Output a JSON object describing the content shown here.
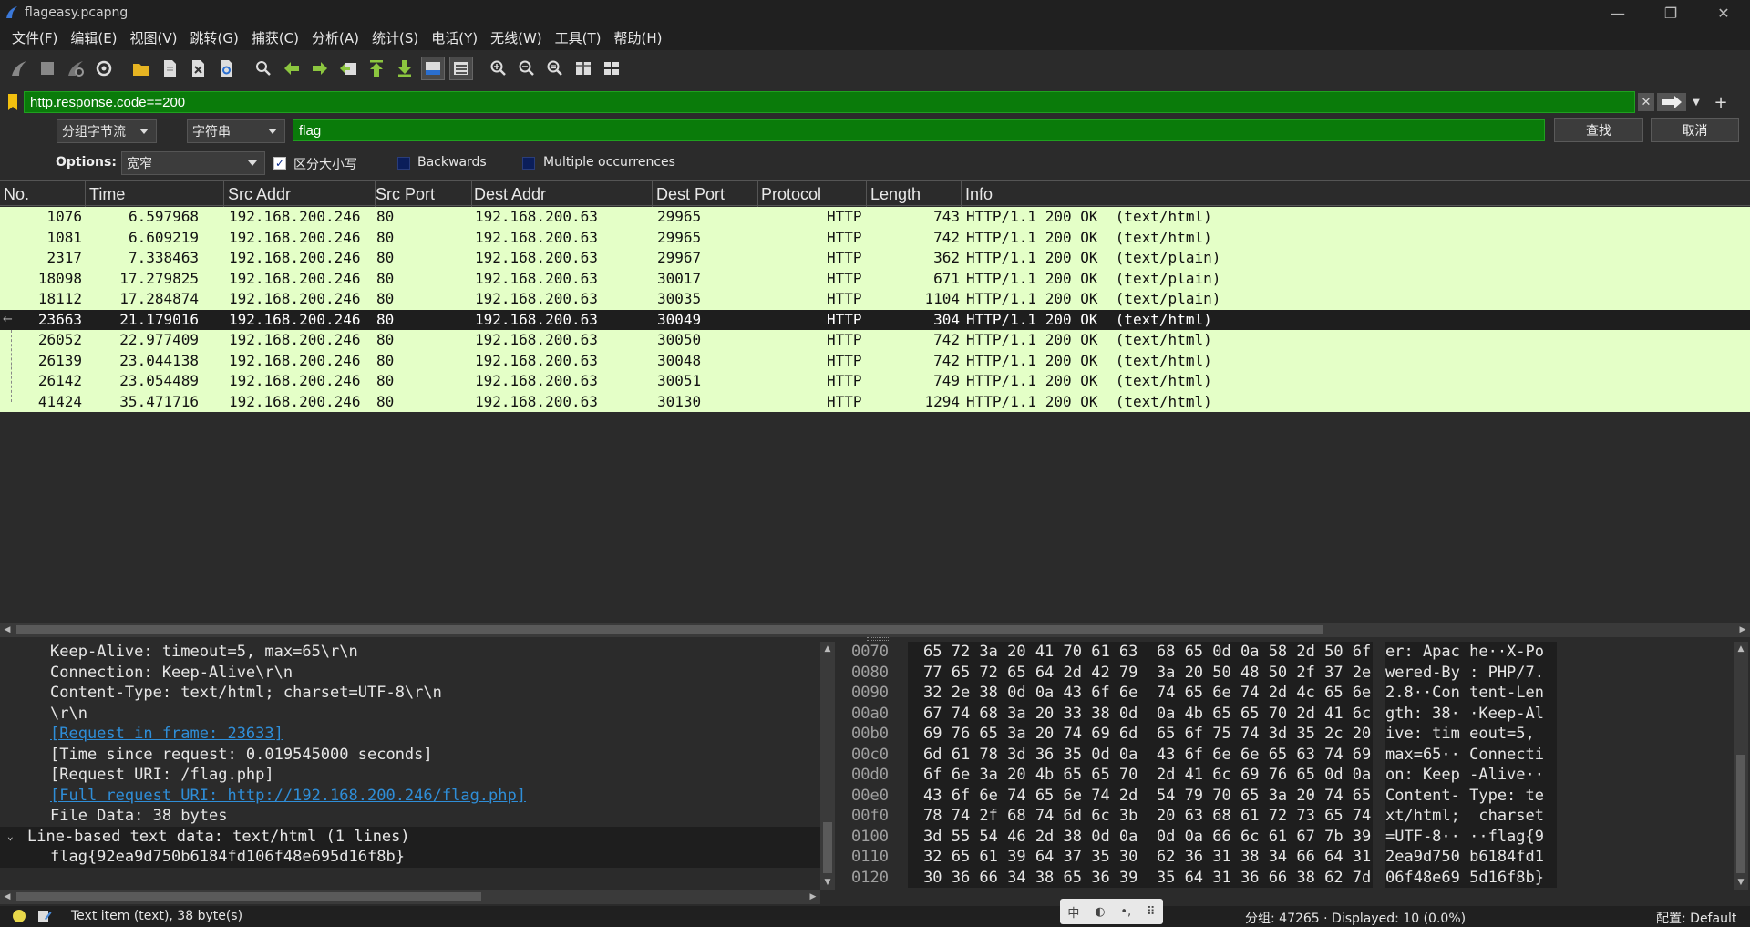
{
  "window": {
    "title": "flageasy.pcapng",
    "minimize": "—",
    "restore": "❐",
    "close": "✕"
  },
  "menu": [
    "文件(F)",
    "编辑(E)",
    "视图(V)",
    "跳转(G)",
    "捕获(C)",
    "分析(A)",
    "统计(S)",
    "电话(Y)",
    "无线(W)",
    "工具(T)",
    "帮助(H)"
  ],
  "filter": {
    "value": "http.response.code==200",
    "clear_glyph": "✕",
    "add_glyph": "+"
  },
  "find": {
    "search_in": "分组字节流",
    "search_type": "字符串",
    "query": "flag",
    "find_button": "查找",
    "cancel_button": "取消",
    "options_label": "Options:",
    "charset": "宽窄",
    "case_sensitive": "区分大小写",
    "case_sensitive_checked": true,
    "backwards": "Backwards",
    "backwards_checked": false,
    "multiple": "Multiple occurrences",
    "multiple_checked": false,
    "check_glyph": "✓"
  },
  "packet_list": {
    "columns": [
      "No.",
      "Time",
      "Src Addr",
      "Src Port",
      "Dest Addr",
      "Dest Port",
      "Protocol",
      "Length",
      "Info"
    ],
    "rows": [
      {
        "no": "1076",
        "time": "6.597968",
        "src": "192.168.200.246",
        "sport": "80",
        "dst": "192.168.200.63",
        "dport": "29965",
        "proto": "HTTP",
        "len": "743",
        "info": "HTTP/1.1 200 OK  (text/html)"
      },
      {
        "no": "1081",
        "time": "6.609219",
        "src": "192.168.200.246",
        "sport": "80",
        "dst": "192.168.200.63",
        "dport": "29965",
        "proto": "HTTP",
        "len": "742",
        "info": "HTTP/1.1 200 OK  (text/html)"
      },
      {
        "no": "2317",
        "time": "7.338463",
        "src": "192.168.200.246",
        "sport": "80",
        "dst": "192.168.200.63",
        "dport": "29967",
        "proto": "HTTP",
        "len": "362",
        "info": "HTTP/1.1 200 OK  (text/plain)"
      },
      {
        "no": "18098",
        "time": "17.279825",
        "src": "192.168.200.246",
        "sport": "80",
        "dst": "192.168.200.63",
        "dport": "30017",
        "proto": "HTTP",
        "len": "671",
        "info": "HTTP/1.1 200 OK  (text/plain)"
      },
      {
        "no": "18112",
        "time": "17.284874",
        "src": "192.168.200.246",
        "sport": "80",
        "dst": "192.168.200.63",
        "dport": "30035",
        "proto": "HTTP",
        "len": "1104",
        "info": "HTTP/1.1 200 OK  (text/plain)"
      },
      {
        "no": "23663",
        "time": "21.179016",
        "src": "192.168.200.246",
        "sport": "80",
        "dst": "192.168.200.63",
        "dport": "30049",
        "proto": "HTTP",
        "len": "304",
        "info": "HTTP/1.1 200 OK  (text/html)",
        "selected": true
      },
      {
        "no": "26052",
        "time": "22.977409",
        "src": "192.168.200.246",
        "sport": "80",
        "dst": "192.168.200.63",
        "dport": "30050",
        "proto": "HTTP",
        "len": "742",
        "info": "HTTP/1.1 200 OK  (text/html)"
      },
      {
        "no": "26139",
        "time": "23.044138",
        "src": "192.168.200.246",
        "sport": "80",
        "dst": "192.168.200.63",
        "dport": "30048",
        "proto": "HTTP",
        "len": "742",
        "info": "HTTP/1.1 200 OK  (text/html)"
      },
      {
        "no": "26142",
        "time": "23.054489",
        "src": "192.168.200.246",
        "sport": "80",
        "dst": "192.168.200.63",
        "dport": "30051",
        "proto": "HTTP",
        "len": "749",
        "info": "HTTP/1.1 200 OK  (text/html)"
      },
      {
        "no": "41424",
        "time": "35.471716",
        "src": "192.168.200.246",
        "sport": "80",
        "dst": "192.168.200.63",
        "dport": "30130",
        "proto": "HTTP",
        "len": "1294",
        "info": "HTTP/1.1 200 OK  (text/html)"
      }
    ]
  },
  "details": {
    "rows": [
      {
        "text": "Keep-Alive: timeout=5, max=65\\r\\n",
        "indent": 2
      },
      {
        "text": "Connection: Keep-Alive\\r\\n",
        "indent": 2
      },
      {
        "text": "Content-Type: text/html; charset=UTF-8\\r\\n",
        "indent": 2
      },
      {
        "text": "\\r\\n",
        "indent": 2
      },
      {
        "text": "[Request in frame: 23633]",
        "indent": 2,
        "link": true
      },
      {
        "text": "[Time since request: 0.019545000 seconds]",
        "indent": 2
      },
      {
        "text": "[Request URI: /flag.php]",
        "indent": 2
      },
      {
        "text": "[Full request URI: http://192.168.200.246/flag.php]",
        "indent": 2,
        "link": true
      },
      {
        "text": "File Data: 38 bytes",
        "indent": 2
      },
      {
        "text": "Line-based text data: text/html (1 lines)",
        "indent": 1,
        "expanded": true,
        "header": true
      },
      {
        "text": "flag{92ea9d750b6184fd106f48e695d16f8b}",
        "indent": 2,
        "child": true
      }
    ],
    "expander_glyph": "⌄"
  },
  "bytes": {
    "rows": [
      {
        "offset": "0070",
        "hex": "65 72 3a 20 41 70 61 63  68 65 0d 0a 58 2d 50 6f",
        "ascii": "er: Apac he··X-Po"
      },
      {
        "offset": "0080",
        "hex": "77 65 72 65 64 2d 42 79  3a 20 50 48 50 2f 37 2e",
        "ascii": "wered-By : PHP/7."
      },
      {
        "offset": "0090",
        "hex": "32 2e 38 0d 0a 43 6f 6e  74 65 6e 74 2d 4c 65 6e",
        "ascii": "2.8··Con tent-Len"
      },
      {
        "offset": "00a0",
        "hex": "67 74 68 3a 20 33 38 0d  0a 4b 65 65 70 2d 41 6c",
        "ascii": "gth: 38· ·Keep-Al"
      },
      {
        "offset": "00b0",
        "hex": "69 76 65 3a 20 74 69 6d  65 6f 75 74 3d 35 2c 20",
        "ascii": "ive: tim eout=5, "
      },
      {
        "offset": "00c0",
        "hex": "6d 61 78 3d 36 35 0d 0a  43 6f 6e 6e 65 63 74 69",
        "ascii": "max=65·· Connecti"
      },
      {
        "offset": "00d0",
        "hex": "6f 6e 3a 20 4b 65 65 70  2d 41 6c 69 76 65 0d 0a",
        "ascii": "on: Keep -Alive··"
      },
      {
        "offset": "00e0",
        "hex": "43 6f 6e 74 65 6e 74 2d  54 79 70 65 3a 20 74 65",
        "ascii": "Content- Type: te"
      },
      {
        "offset": "00f0",
        "hex": "78 74 2f 68 74 6d 6c 3b  20 63 68 61 72 73 65 74",
        "ascii": "xt/html;  charset"
      },
      {
        "offset": "0100",
        "hex": "3d 55 54 46 2d 38 0d 0a  0d 0a 66 6c 61 67 7b 39",
        "ascii": "=UTF-8·· ··flag{9"
      },
      {
        "offset": "0110",
        "hex": "32 65 61 39 64 37 35 30  62 36 31 38 34 66 64 31",
        "ascii": "2ea9d750 b6184fd1"
      },
      {
        "offset": "0120",
        "hex": "30 36 66 34 38 65 36 39  35 64 31 36 66 38 62 7d",
        "ascii": "06f48e69 5d16f8b}"
      }
    ]
  },
  "status": {
    "item": "Text item (text), 38 byte(s)",
    "stats": "分组: 47265 · Displayed: 10 (0.0%)",
    "profile": "配置: Default"
  },
  "ime": {
    "glyphs": [
      "中",
      "◐",
      "•,",
      "⠿"
    ]
  },
  "colors": {
    "row_bg": "#e4ffc7",
    "selected_bg": "#1e1e1e",
    "filter_ok": "#0a7b0a",
    "link": "#2f8ed8"
  }
}
